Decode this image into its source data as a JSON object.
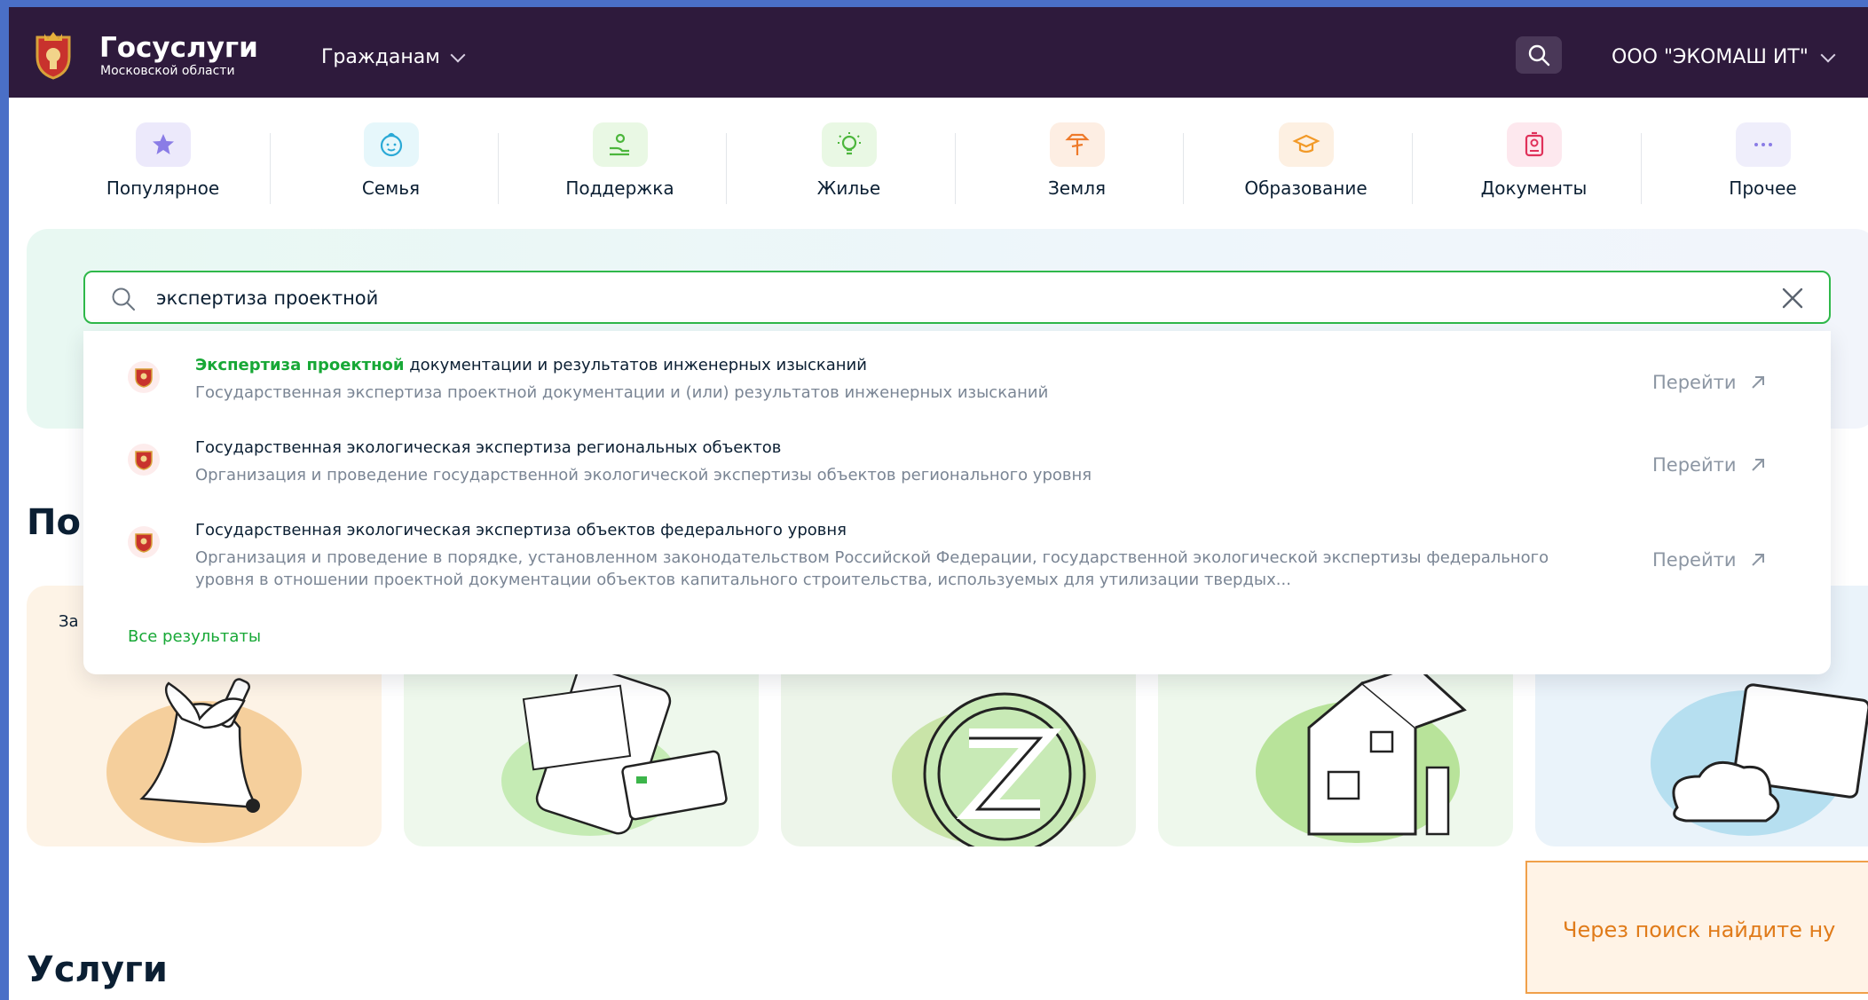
{
  "header": {
    "brand_title": "Госуслуги",
    "brand_subtitle": "Московской области",
    "nav_citizens": "Гражданам",
    "org_name": "ООО \"ЭКОМАШ ИТ\""
  },
  "categories": [
    {
      "label": "Популярное",
      "icon": "star-icon",
      "color": "#ece9fb"
    },
    {
      "label": "Семья",
      "icon": "baby-icon",
      "color": "#e6f7fb"
    },
    {
      "label": "Поддержка",
      "icon": "hand-icon",
      "color": "#e9f8e4"
    },
    {
      "label": "Жилье",
      "icon": "lightbulb-icon",
      "color": "#e9f8e4"
    },
    {
      "label": "Земля",
      "icon": "shovel-icon",
      "color": "#fdeee3"
    },
    {
      "label": "Образование",
      "icon": "graduation-cap-icon",
      "color": "#fdf0e2"
    },
    {
      "label": "Документы",
      "icon": "id-badge-icon",
      "color": "#fde8ee"
    },
    {
      "label": "Прочее",
      "icon": "more-icon",
      "color": "#efeefb"
    }
  ],
  "search": {
    "value": "экспертиза проектной",
    "placeholder": ""
  },
  "results": [
    {
      "title_highlight": "Экспертиза проектной",
      "title_rest": " документации и результатов инженерных изысканий",
      "desc": "Государственная экспертиза проектной документации и (или) результатов инженерных изысканий",
      "go": "Перейти"
    },
    {
      "title_highlight": "",
      "title_rest": "Государственная экологическая экспертиза региональных объектов",
      "desc": "Организация и проведение государственной экологической экспертизы объектов регионального уровня",
      "go": "Перейти"
    },
    {
      "title_highlight": "",
      "title_rest": "Государственная экологическая экспертиза объектов федерального уровня",
      "desc": "Организация и проведение в порядке, установленном законодательством Российской Федерации, государственной экологической экспертизы федерального уровня в отношении проектной документации объектов капитального строительства, используемых для утилизации твердых...",
      "go": "Перейти"
    }
  ],
  "all_results": "Все результаты",
  "section_title_partial": "По",
  "card_label_partial": "За",
  "services_title": "Услуги",
  "hint_text": "Через поиск найдите ну",
  "colors": {
    "header_bg": "#2e1a3c",
    "accent_green": "#17a836",
    "hint_orange": "#e07b1a"
  }
}
